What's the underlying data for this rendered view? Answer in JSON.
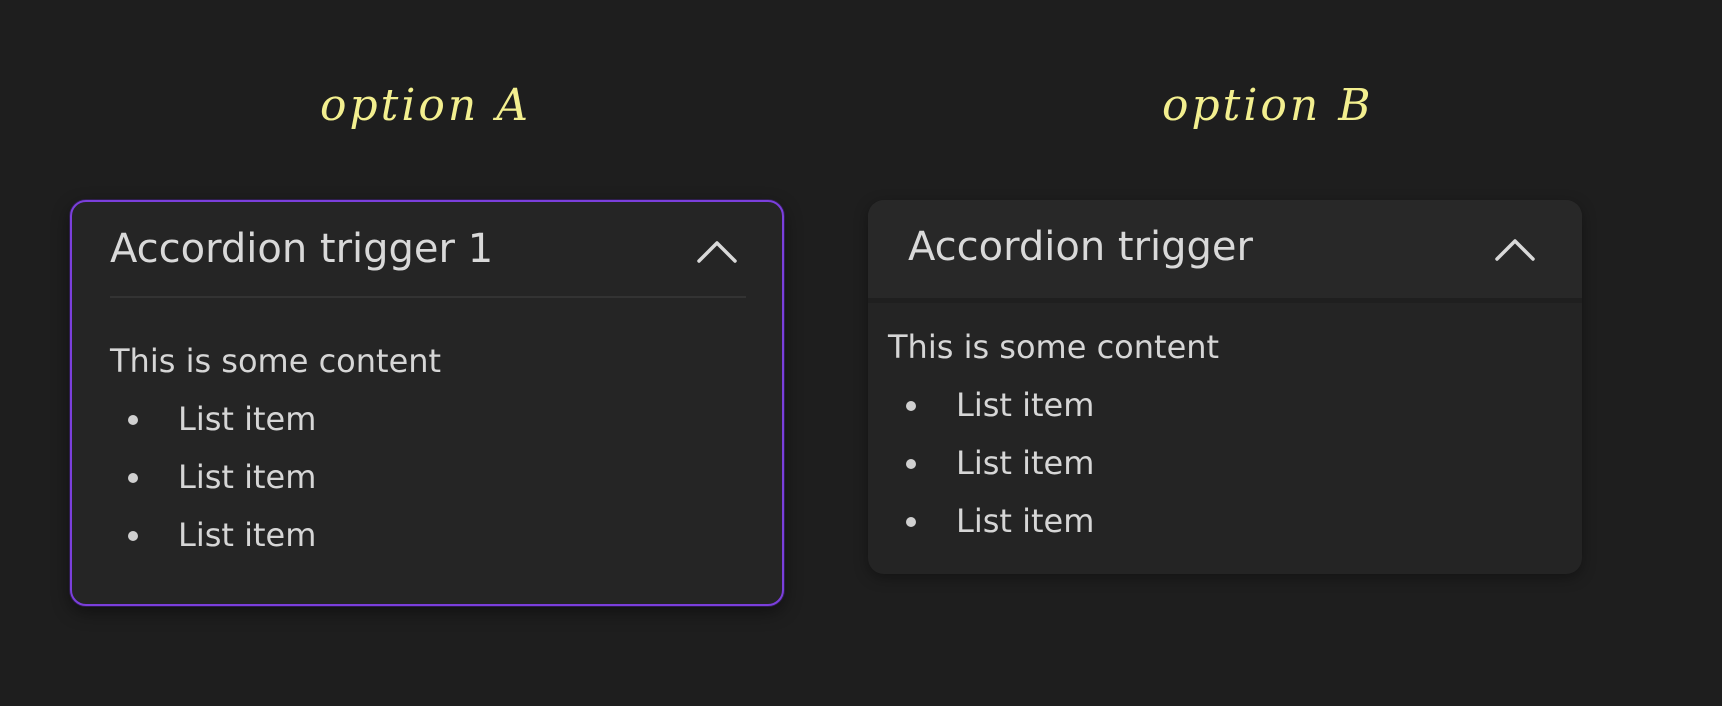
{
  "options": {
    "a": {
      "label": "option A",
      "trigger": "Accordion trigger 1",
      "content_text": "This is some content",
      "items": [
        "List item",
        "List item",
        "List item"
      ],
      "border_color": "#7b3fdc"
    },
    "b": {
      "label": "option B",
      "trigger": "Accordion trigger",
      "content_text": "This is some content",
      "items": [
        "List item",
        "List item",
        "List item"
      ]
    }
  },
  "colors": {
    "background": "#1e1e1e",
    "panel": "#252525",
    "label_yellow": "#f3ef8f",
    "text": "#d6d6d6"
  },
  "icons": {
    "expand_state": "chevron-up-icon"
  }
}
